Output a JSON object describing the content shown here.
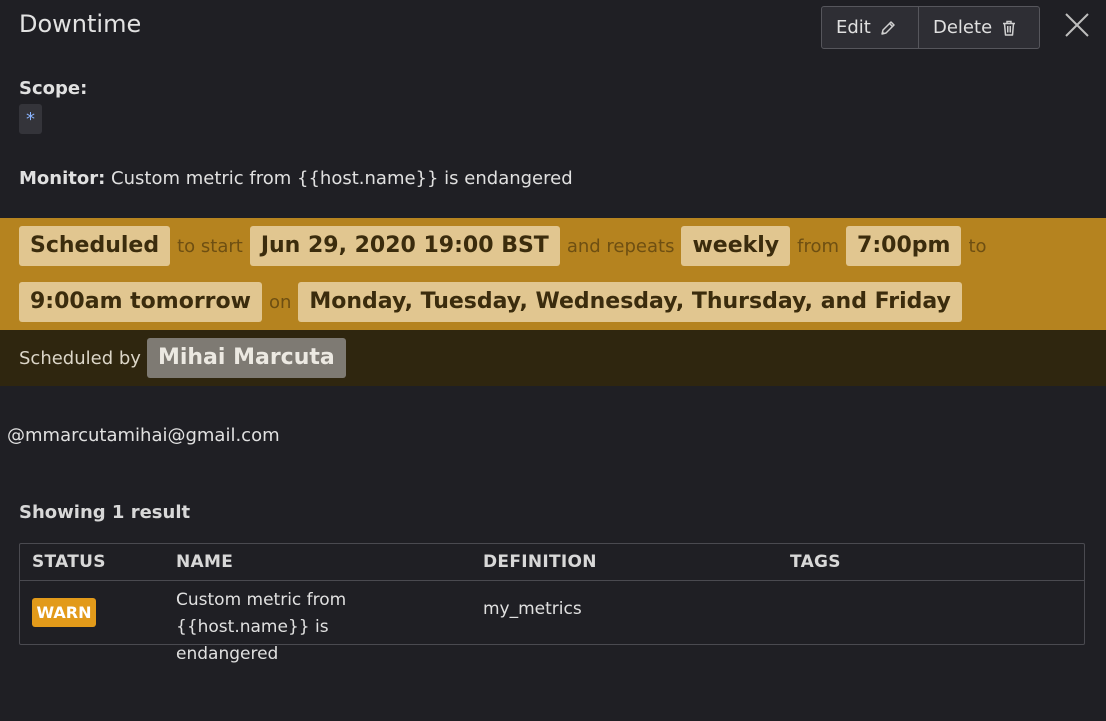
{
  "header": {
    "title": "Downtime",
    "edit_label": "Edit",
    "delete_label": "Delete"
  },
  "scope": {
    "label": "Scope:",
    "value": "*"
  },
  "monitor": {
    "label": "Monitor:",
    "value": "Custom metric from {{host.name}} is endangered"
  },
  "schedule": {
    "status": "Scheduled",
    "to_start_text": "to start",
    "start": "Jun 29, 2020 19:00 BST",
    "repeats_text": "and repeats",
    "frequency": "weekly",
    "from_text": "from",
    "from_time": "7:00pm",
    "to_text": "to",
    "to_time": "9:00am tomorrow",
    "on_text": "on",
    "days": "Monday, Tuesday, Wednesday, Thursday, and Friday"
  },
  "byline": {
    "text": "Scheduled by",
    "user": "Mihai Marcuta"
  },
  "message": "@mmarcutamihai@gmail.com",
  "results": {
    "summary": "Showing 1 result",
    "columns": [
      "STATUS",
      "NAME",
      "DEFINITION",
      "TAGS"
    ],
    "rows": [
      {
        "status": "WARN",
        "name": "Custom metric from {{host.name}} is endangered",
        "definition": "my_metrics",
        "tags": ""
      }
    ]
  },
  "colors": {
    "background": "#1f1f24",
    "schedule_band": "#b5831f",
    "schedule_pill": "#e1c690",
    "byline_band": "#2f260f",
    "warn": "#e29a1a"
  },
  "icons": {
    "edit": "pencil-icon",
    "delete": "trash-icon",
    "close": "close-icon"
  }
}
